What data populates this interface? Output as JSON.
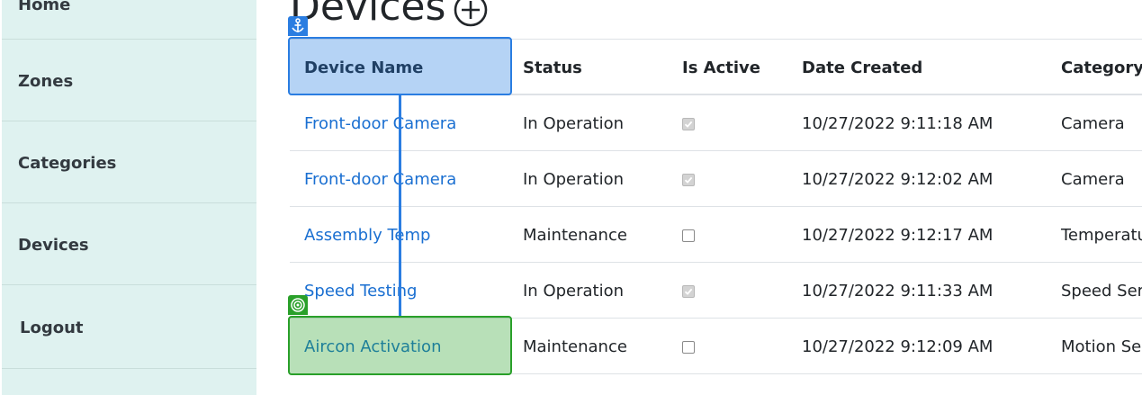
{
  "sidebar": {
    "items": [
      {
        "label": "Home"
      },
      {
        "label": "Zones"
      },
      {
        "label": "Categories"
      },
      {
        "label": "Devices"
      },
      {
        "label": "Logout"
      }
    ]
  },
  "main": {
    "title": "Devices",
    "add_icon": "circle-plus-icon",
    "table": {
      "headers": [
        "Device Name",
        "Status",
        "Is Active",
        "Date Created",
        "Category"
      ],
      "rows": [
        {
          "name": "Front-door Camera",
          "status": "In Operation",
          "is_active": true,
          "date_created": "10/27/2022 9:11:18 AM",
          "category": "Camera"
        },
        {
          "name": "Front-door Camera",
          "status": "In Operation",
          "is_active": true,
          "date_created": "10/27/2022 9:12:02 AM",
          "category": "Camera"
        },
        {
          "name": "Assembly Temp",
          "status": "Maintenance",
          "is_active": false,
          "date_created": "10/27/2022 9:12:17 AM",
          "category": "Temperatu"
        },
        {
          "name": "Speed Testing",
          "status": "In Operation",
          "is_active": true,
          "date_created": "10/27/2022 9:11:33 AM",
          "category": "Speed Ser"
        },
        {
          "name": "Aircon Activation",
          "status": "Maintenance",
          "is_active": false,
          "date_created": "10/27/2022 9:12:09 AM",
          "category": "Motion Se"
        }
      ]
    }
  },
  "overlay": {
    "anchor_icon": "anchor-icon",
    "target_icon": "target-icon",
    "anchor_color": "#2a7de1",
    "target_color": "#2aa02a"
  },
  "colors": {
    "sidebar_bg": "#dff2f0",
    "link": "#1a6fd1",
    "text": "#212529"
  }
}
